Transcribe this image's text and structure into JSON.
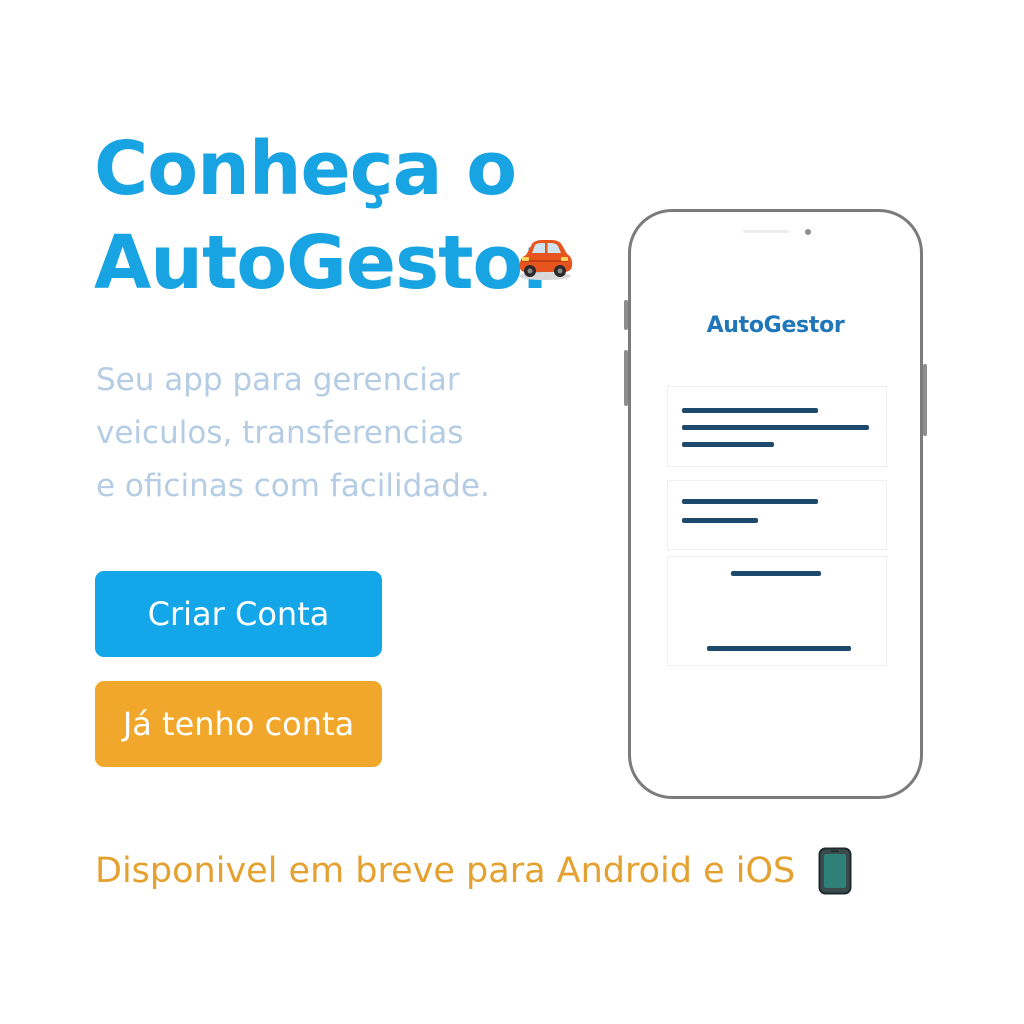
{
  "hero": {
    "headline_line1": "Conheça o",
    "headline_line2": "AutoGestor",
    "headline_emoji": "car-emoji",
    "subtitle_line1": "Seu app para gerenciar",
    "subtitle_line2": "veiculos, transferencias",
    "subtitle_line3": "e oficinas com facilidade."
  },
  "actions": {
    "create_account_label": "Criar Conta",
    "login_label": "Já tenho conta"
  },
  "footer": {
    "availability_text": "Disponivel em breve para Android e iOS",
    "availability_emoji": "mobile-phone-emoji"
  },
  "mockup": {
    "app_title": "AutoGestor"
  },
  "colors": {
    "headline": "#18a3e2",
    "subtitle": "#b5cde4",
    "primary_button": "#13a6e8",
    "secondary_button": "#f1a72b",
    "availability": "#e5a12f",
    "mockup_title": "#1f76b9",
    "mockup_bars": "#1d4a6c"
  }
}
